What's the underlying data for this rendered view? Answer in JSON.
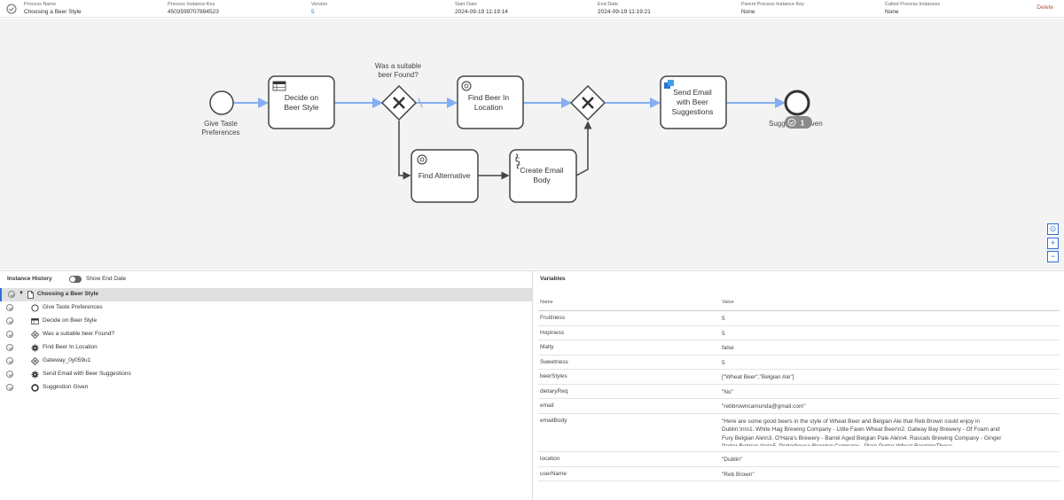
{
  "header": {
    "columns": [
      {
        "label": "Process Name",
        "value": "Choosing a Beer Style"
      },
      {
        "label": "Process Instance Key",
        "value": "4503599707894523"
      },
      {
        "label": "Version",
        "value": "5"
      },
      {
        "label": "Start Date",
        "value": "2024-09-19 11:19:14"
      },
      {
        "label": "End Date",
        "value": "2024-09-19 11:19:21"
      },
      {
        "label": "Parent Process Instance Key",
        "value": "None"
      },
      {
        "label": "Called Process Instances",
        "value": "None"
      }
    ],
    "delete_label": "Delete"
  },
  "diagram": {
    "start_event_label": [
      "Give Taste",
      "Preferences"
    ],
    "task_decide": [
      "Decide on",
      "Beer Style"
    ],
    "gateway_question": [
      "Was a suitable",
      "beer Found?"
    ],
    "task_find_beer": [
      "Find Beer In",
      "Location"
    ],
    "task_find_alt": "Find Alternative",
    "task_email_body": [
      "Create Email",
      "Body"
    ],
    "task_send_email": [
      "Send Email",
      "with Beer",
      "Suggestions"
    ],
    "end_event_label_left": "Sugg",
    "end_event_label_right": "iven",
    "end_badge_count": "1",
    "zoom_reset": "⊙",
    "zoom_in": "+",
    "zoom_out": "−"
  },
  "history": {
    "title": "Instance History",
    "toggle_label": "Show End Date",
    "items": [
      {
        "label": "Choosing a Beer Style",
        "icon": "document-icon"
      },
      {
        "label": "Give Taste Preferences",
        "icon": "start-event-icon"
      },
      {
        "label": "Decide on Beer Style",
        "icon": "business-rule-icon"
      },
      {
        "label": "Was a suitable beer Found?",
        "icon": "gateway-icon"
      },
      {
        "label": "Find Beer In Location",
        "icon": "service-task-icon"
      },
      {
        "label": "Gateway_0y059u1",
        "icon": "gateway-icon"
      },
      {
        "label": "Send Email with Beer Suggestions",
        "icon": "service-task-icon"
      },
      {
        "label": "Suggestion Given",
        "icon": "end-event-icon"
      }
    ]
  },
  "variables": {
    "title": "Variables",
    "col_name": "Name",
    "col_value": "Value",
    "rows": [
      {
        "name": "Fruitiness",
        "value": "5"
      },
      {
        "name": "Hopiness",
        "value": "5"
      },
      {
        "name": "Malty",
        "value": "false"
      },
      {
        "name": "Sweetness",
        "value": "5"
      },
      {
        "name": "beerStyles",
        "value": "[\"Wheat Beer\",\"Belgian Ale\"]"
      },
      {
        "name": "dietaryReq",
        "value": "\"No\""
      },
      {
        "name": "email",
        "value": "\"rebbrowncamunda@gmail.com\""
      },
      {
        "name": "emailBody",
        "value": "\"Here are some good beers in the style of Wheat Beer and Belgian Ale that Reb Brown could enjoy in Dublin:\\n\\n1. White Hag Brewing Company - Little Fawn Wheat Beer\\n2. Galway Bay Brewery - Of Foam and Fury Belgian Ale\\n3. O'Hara's Brewery - Barrel Aged Belgian Pale Ale\\n4. Rascals Brewing Company - Ginger Porter Belgian Ale\\n5. Porterhouse Brewing Company - Plain Porter Wheat Beer\\n\\nThese"
      },
      {
        "name": "location",
        "value": "\"Dublin\""
      },
      {
        "name": "userName",
        "value": "\"Reb Brown\""
      }
    ]
  },
  "colors": {
    "accent": "#2d6fd6",
    "flow_active": "#84aef0",
    "flow_inactive": "#444444",
    "delete": "#b0573a"
  }
}
